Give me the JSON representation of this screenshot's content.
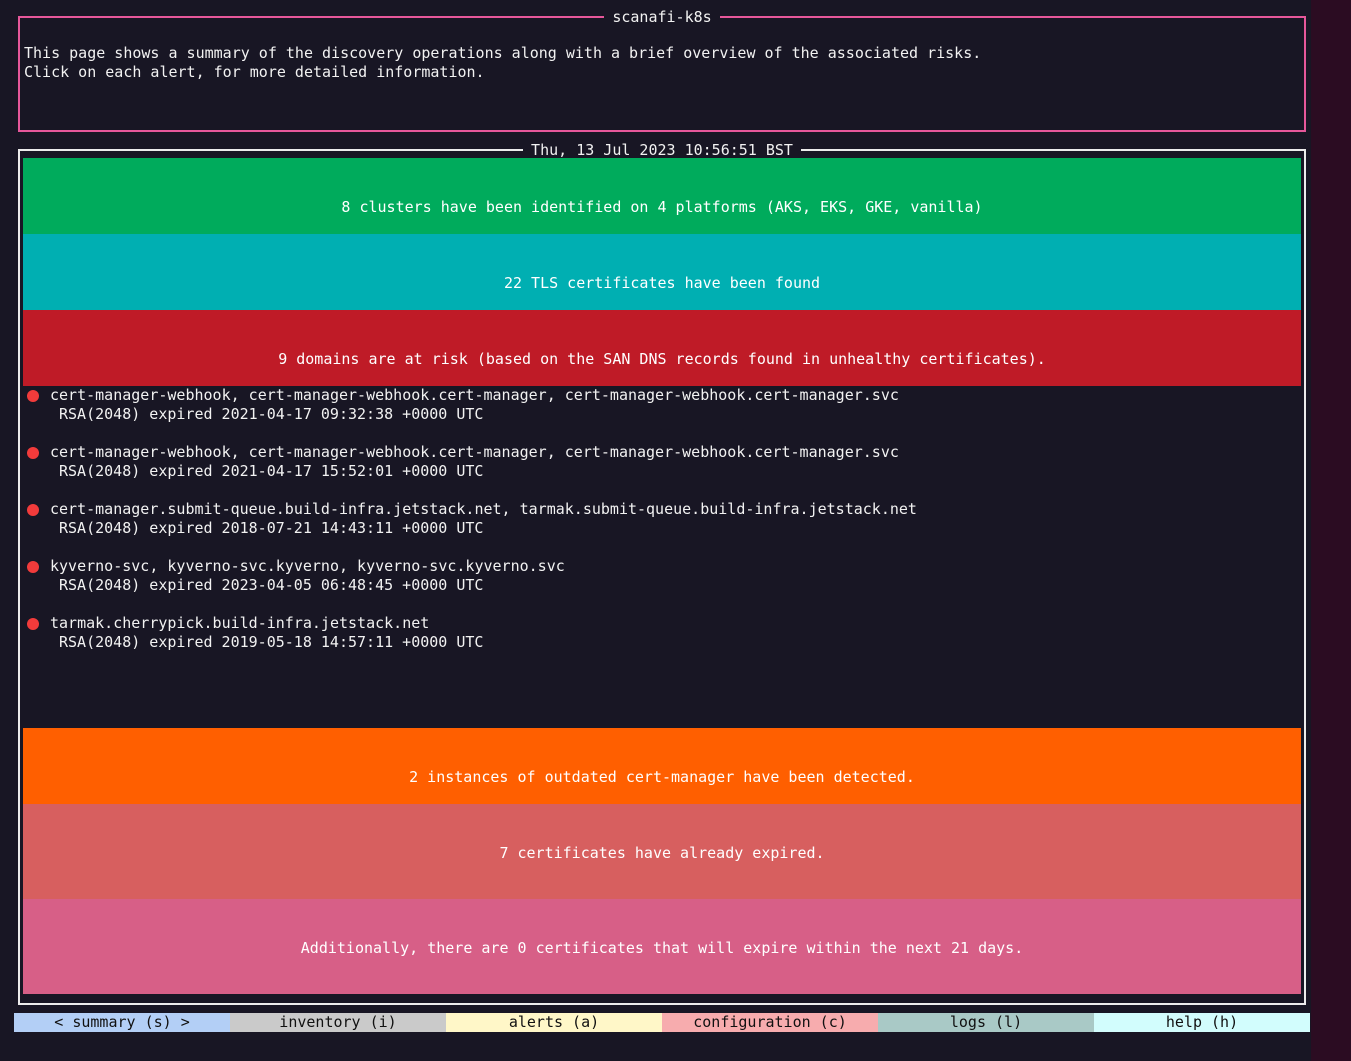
{
  "app": {
    "title": "scanafi-k8s"
  },
  "header": {
    "description_line1": "This page shows a summary of the discovery operations along with a brief overview of the associated risks.",
    "description_line2": "Click on each alert, for more detailed information."
  },
  "summary": {
    "timestamp": "Thu, 13 Jul 2023 10:56:51 BST",
    "clusters_text": "8 clusters have been identified on 4 platforms (AKS, EKS, GKE, vanilla)",
    "tls_text": "22 TLS certificates have been found",
    "domains_text": "9 domains are at risk (based on the SAN DNS records found in unhealthy certificates).",
    "domain_alerts": [
      {
        "names": "cert-manager-webhook, cert-manager-webhook.cert-manager, cert-manager-webhook.cert-manager.svc",
        "detail": "RSA(2048) expired 2021-04-17 09:32:38 +0000 UTC"
      },
      {
        "names": "cert-manager-webhook, cert-manager-webhook.cert-manager, cert-manager-webhook.cert-manager.svc",
        "detail": "RSA(2048) expired 2021-04-17 15:52:01 +0000 UTC"
      },
      {
        "names": "cert-manager.submit-queue.build-infra.jetstack.net, tarmak.submit-queue.build-infra.jetstack.net",
        "detail": "RSA(2048) expired 2018-07-21 14:43:11 +0000 UTC"
      },
      {
        "names": "kyverno-svc, kyverno-svc.kyverno, kyverno-svc.kyverno.svc",
        "detail": "RSA(2048) expired 2023-04-05 06:48:45 +0000 UTC"
      },
      {
        "names": "tarmak.cherrypick.build-infra.jetstack.net",
        "detail": "RSA(2048) expired 2019-05-18 14:57:11 +0000 UTC"
      }
    ],
    "outdated_text": "2 instances of outdated cert-manager have been detected.",
    "expired_text": "7 certificates have already expired.",
    "expiring_text": "Additionally, there are 0 certificates that will expire within the next 21 days."
  },
  "tabs": [
    {
      "label": "< summary (s) >",
      "color": "#b3cff6"
    },
    {
      "label": "inventory (i)",
      "color": "#cacaca"
    },
    {
      "label": "alerts (a)",
      "color": "#fff7c8"
    },
    {
      "label": "configuration (c)",
      "color": "#f7acae"
    },
    {
      "label": "logs (l)",
      "color": "#a9c9c6"
    },
    {
      "label": "help (h)",
      "color": "#d2fdfd"
    }
  ],
  "colors": {
    "clusters": "#00ab5c",
    "tls": "#00afb2",
    "domains": "#bf1b27",
    "outdated": "#ff5f00",
    "expired": "#d75f5f",
    "expiring": "#d75f87",
    "alert_dot": "#f23b3b"
  }
}
